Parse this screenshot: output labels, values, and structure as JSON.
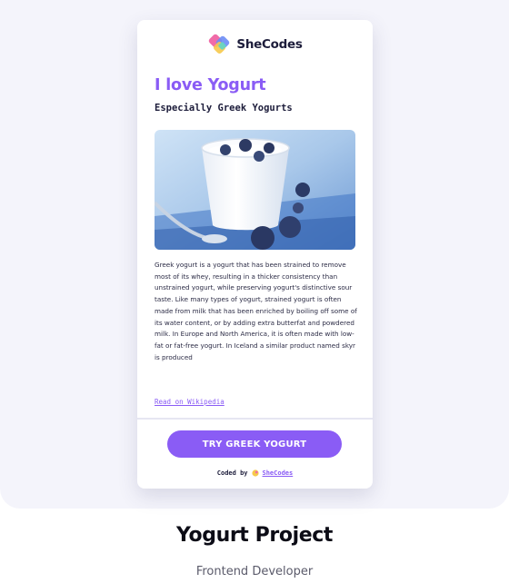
{
  "card": {
    "brand_name": "SheCodes",
    "title": "I love Yogurt",
    "subtitle": "Especially Greek Yogurts",
    "image_icon": "greek-yogurt-bowl-with-blueberries",
    "description": "Greek yogurt is a yogurt that has been strained to remove most of its whey, resulting in a thicker consistency than unstrained yogurt, while preserving yogurt's distinctive sour taste. Like many types of yogurt, strained yogurt is often made from milk that has been enriched by boiling off some of its water content, or by adding extra butterfat and powdered milk. In Europe and North America, it is often made with low-fat or fat-free yogurt. In Iceland a similar product named skyr is produced",
    "wiki_link": "Read on Wikipedia",
    "cta_label": "TRY GREEK YOGURT",
    "credit_prefix": "Coded by",
    "credit_link": "SheCodes"
  },
  "project": {
    "title": "Yogurt Project",
    "role": "Frontend Developer"
  },
  "colors": {
    "accent": "#8a5cf5",
    "heading": "#1d1d3b",
    "stage_bg": "#f4f4fb"
  }
}
